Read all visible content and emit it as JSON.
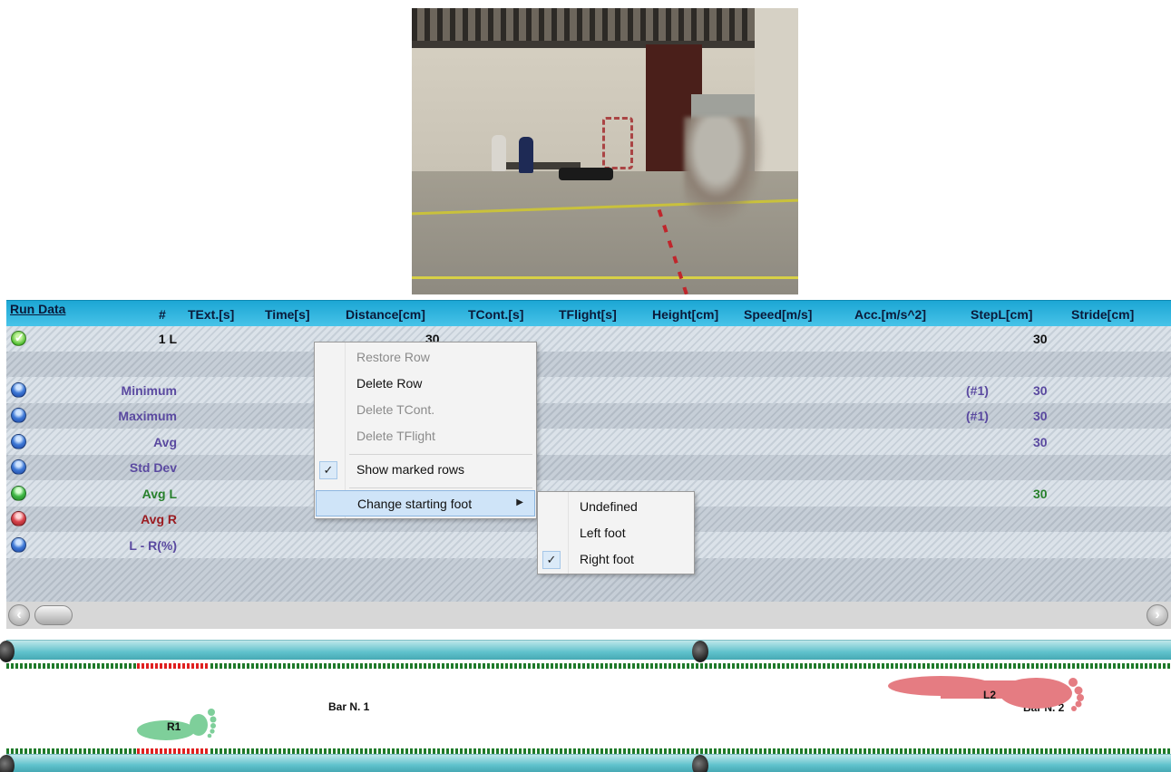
{
  "table": {
    "header": {
      "run_data": "Run Data",
      "columns": [
        "#",
        "TExt.[s]",
        "Time[s]",
        "Distance[cm]",
        "TCont.[s]",
        "TFlight[s]",
        "Height[cm]",
        "Speed[m/s]",
        "Acc.[m/s^2]",
        "StepL[cm]",
        "Stride[cm]"
      ]
    },
    "rows": [
      {
        "label": "1 L",
        "distance": "30",
        "stepl": "30",
        "stepl_ref": ""
      },
      {
        "label": "",
        "distance": "",
        "stepl": "",
        "stepl_ref": ""
      },
      {
        "label": "Minimum",
        "stepl_ref": "(#1)",
        "stepl": "30"
      },
      {
        "label": "Maximum",
        "stepl_ref": "(#1)",
        "stepl": "30"
      },
      {
        "label": "Avg",
        "stepl_ref": "",
        "stepl": "30"
      },
      {
        "label": "Std Dev",
        "stepl_ref": "",
        "stepl": ""
      },
      {
        "label": "Avg L",
        "stepl_ref": "",
        "stepl": "30"
      },
      {
        "label": "Avg R",
        "stepl_ref": "",
        "stepl": ""
      },
      {
        "label": "L - R(%)",
        "stepl_ref": "",
        "stepl": ""
      }
    ]
  },
  "context_menu": {
    "items": [
      {
        "label": "Restore Row",
        "enabled": false
      },
      {
        "label": "Delete Row",
        "enabled": true
      },
      {
        "label": "Delete TCont.",
        "enabled": false
      },
      {
        "label": "Delete TFlight",
        "enabled": false
      },
      {
        "label": "Show marked rows",
        "checked": true
      },
      {
        "label": "Change starting foot",
        "submenu": true
      }
    ],
    "check_mark": "✓",
    "submenu_arrow": "▶"
  },
  "submenu": {
    "items": [
      {
        "label": "Undefined",
        "checked": false
      },
      {
        "label": "Left foot",
        "checked": false
      },
      {
        "label": "Right foot",
        "checked": true
      }
    ]
  },
  "scroll": {
    "left_arrow": "‹",
    "right_arrow": "›"
  },
  "timeline": {
    "bar1": "Bar N. 1",
    "bar2": "Bar N. 2",
    "foot_r1": "R1",
    "foot_l2": "L2"
  },
  "colors": {
    "header": "#1ca6d4",
    "stat_blue": "#5a49a0",
    "stat_green": "#27802b",
    "stat_red": "#9b1c21",
    "foot_green": "#7ecf9a",
    "foot_red": "#e57c82"
  }
}
